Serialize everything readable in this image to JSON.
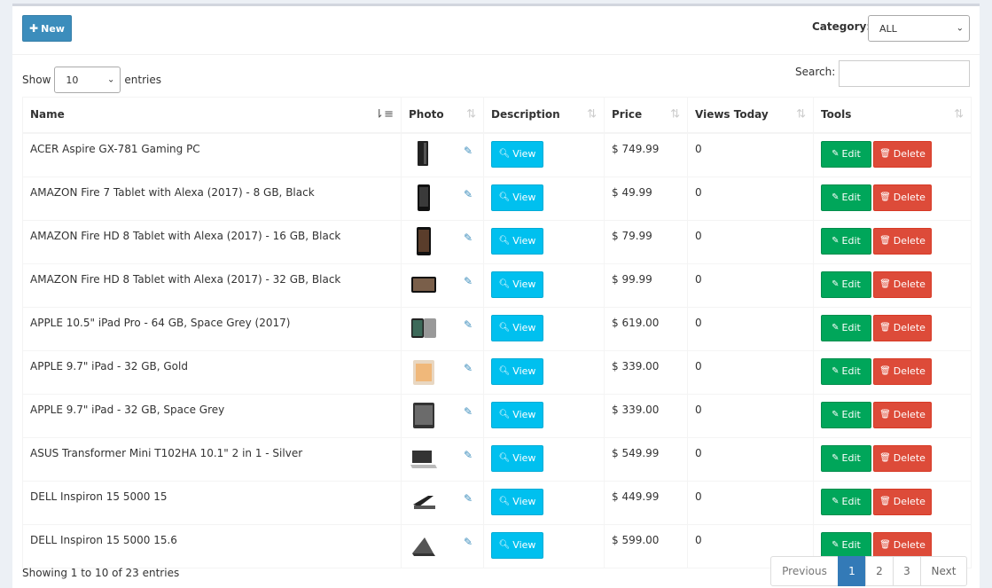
{
  "toolbar": {
    "new_label": "New"
  },
  "category": {
    "label": "Category:",
    "selected": "ALL"
  },
  "length": {
    "show_label": "Show",
    "selected": "10",
    "entries_label": "entries"
  },
  "search": {
    "label": "Search:",
    "value": ""
  },
  "columns": {
    "name": "Name",
    "photo": "Photo",
    "description": "Description",
    "price": "Price",
    "views": "Views Today",
    "tools": "Tools"
  },
  "row_labels": {
    "view": "View",
    "edit": "Edit",
    "delete": "Delete"
  },
  "rows": [
    {
      "name": "ACER Aspire GX-781 Gaming PC",
      "price": "$ 749.99",
      "views": "0"
    },
    {
      "name": "AMAZON Fire 7 Tablet with Alexa (2017) - 8 GB, Black",
      "price": "$ 49.99",
      "views": "0"
    },
    {
      "name": "AMAZON Fire HD 8 Tablet with Alexa (2017) - 16 GB, Black",
      "price": "$ 79.99",
      "views": "0"
    },
    {
      "name": "AMAZON Fire HD 8 Tablet with Alexa (2017) - 32 GB, Black",
      "price": "$ 99.99",
      "views": "0"
    },
    {
      "name": "APPLE 10.5\" iPad Pro - 64 GB, Space Grey (2017)",
      "price": "$ 619.00",
      "views": "0"
    },
    {
      "name": "APPLE 9.7\" iPad - 32 GB, Gold",
      "price": "$ 339.00",
      "views": "0"
    },
    {
      "name": "APPLE 9.7\" iPad - 32 GB, Space Grey",
      "price": "$ 339.00",
      "views": "0"
    },
    {
      "name": "ASUS Transformer Mini T102HA 10.1\" 2 in 1 - Silver",
      "price": "$ 549.99",
      "views": "0"
    },
    {
      "name": "DELL Inspiron 15 5000 15",
      "price": "$ 449.99",
      "views": "0"
    },
    {
      "name": "DELL Inspiron 15 5000 15.6",
      "price": "$ 599.00",
      "views": "0"
    }
  ],
  "footer": {
    "info": "Showing 1 to 10 of 23 entries"
  },
  "pagination": {
    "previous": "Previous",
    "pages": [
      "1",
      "2",
      "3"
    ],
    "active": "1",
    "next": "Next"
  },
  "colors": {
    "primary": "#3c8dbc",
    "info": "#00c0ef",
    "success": "#00a65a",
    "danger": "#dd4b39",
    "page_active": "#337ab7"
  }
}
